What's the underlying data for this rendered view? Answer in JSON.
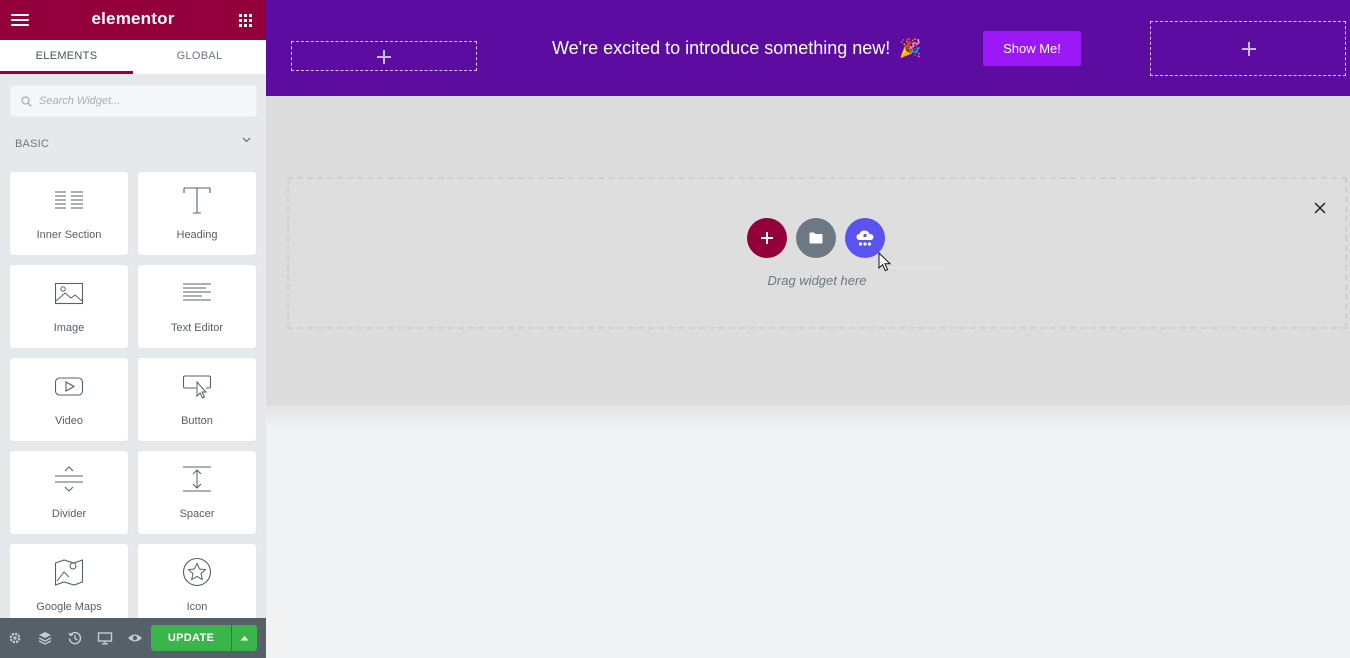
{
  "app": {
    "logo": "elementor"
  },
  "tabs": [
    {
      "label": "ELEMENTS",
      "active": true
    },
    {
      "label": "GLOBAL",
      "active": false
    }
  ],
  "search": {
    "placeholder": "Search Widget...",
    "value": ""
  },
  "category": {
    "label": "BASIC"
  },
  "widgets": [
    {
      "label": "Inner Section",
      "icon": "inner-section-icon"
    },
    {
      "label": "Heading",
      "icon": "heading-icon"
    },
    {
      "label": "Image",
      "icon": "image-icon"
    },
    {
      "label": "Text Editor",
      "icon": "text-editor-icon"
    },
    {
      "label": "Video",
      "icon": "video-icon"
    },
    {
      "label": "Button",
      "icon": "button-icon"
    },
    {
      "label": "Divider",
      "icon": "divider-icon"
    },
    {
      "label": "Spacer",
      "icon": "spacer-icon"
    },
    {
      "label": "Google Maps",
      "icon": "google-maps-icon"
    },
    {
      "label": "Icon",
      "icon": "star-icon"
    }
  ],
  "bottombar": {
    "update_label": "UPDATE",
    "icons": [
      "settings-icon",
      "navigator-icon",
      "history-icon",
      "responsive-icon",
      "preview-icon"
    ]
  },
  "banner": {
    "text": "We're excited to introduce something new!",
    "emoji": "🎉",
    "button_label": "Show Me!"
  },
  "dropzone": {
    "hint": "Drag widget here"
  },
  "colors": {
    "brand": "#93003c",
    "banner_bg": "#5c0ca0",
    "banner_button": "#9b17f5",
    "update_green": "#39b54a",
    "ai_button": "#5a53f0"
  }
}
